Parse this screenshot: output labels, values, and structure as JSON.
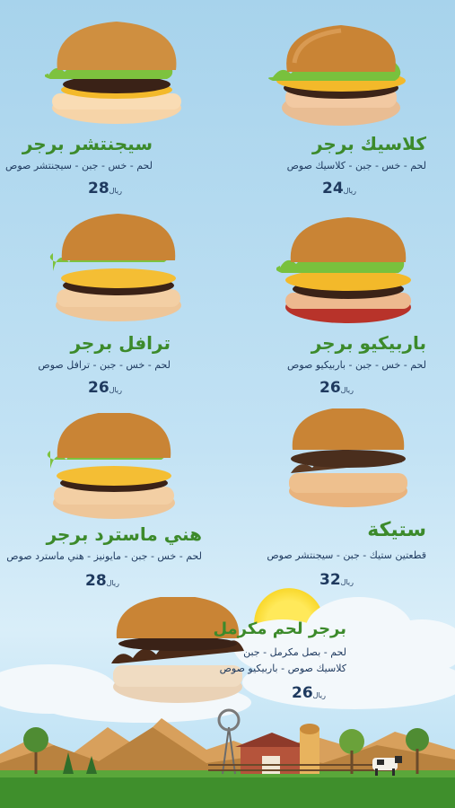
{
  "menu": {
    "currency": "ريال",
    "items": [
      {
        "name": "كلاسيك برجر",
        "desc": "لحم - خس - جبن - كلاسيك صوص",
        "price": "24"
      },
      {
        "name": "سيجنتشر برجر",
        "desc": "لحم - خس - جبن - سيجنتشر صوص",
        "price": "28"
      },
      {
        "name": "باربيكيو برجر",
        "desc": "لحم - خس - جبن - باربيكيو صوص",
        "price": "26"
      },
      {
        "name": "ترافل برجر",
        "desc": "لحم - خس - جبن - ترافل صوص",
        "price": "26"
      },
      {
        "name": "ستيكة",
        "desc": "قطعتين ستيك - جبن - سيجنتشر صوص",
        "price": "32"
      },
      {
        "name": "هني ماسترد برجر",
        "desc": "لحم - خس - جبن - مايونيز - هني ماسترد صوص",
        "price": "28"
      },
      {
        "name": "برجر لحم مكرمل",
        "desc_lines": [
          "لحم - بصل مكرمل - جبن",
          "كلاسيك صوص - باربيكيو صوص"
        ],
        "price": "26"
      }
    ]
  },
  "colors": {
    "name_green": "#3c8a2b",
    "text_navy": "#1f3a5f",
    "sky": "#a7d3ec"
  }
}
